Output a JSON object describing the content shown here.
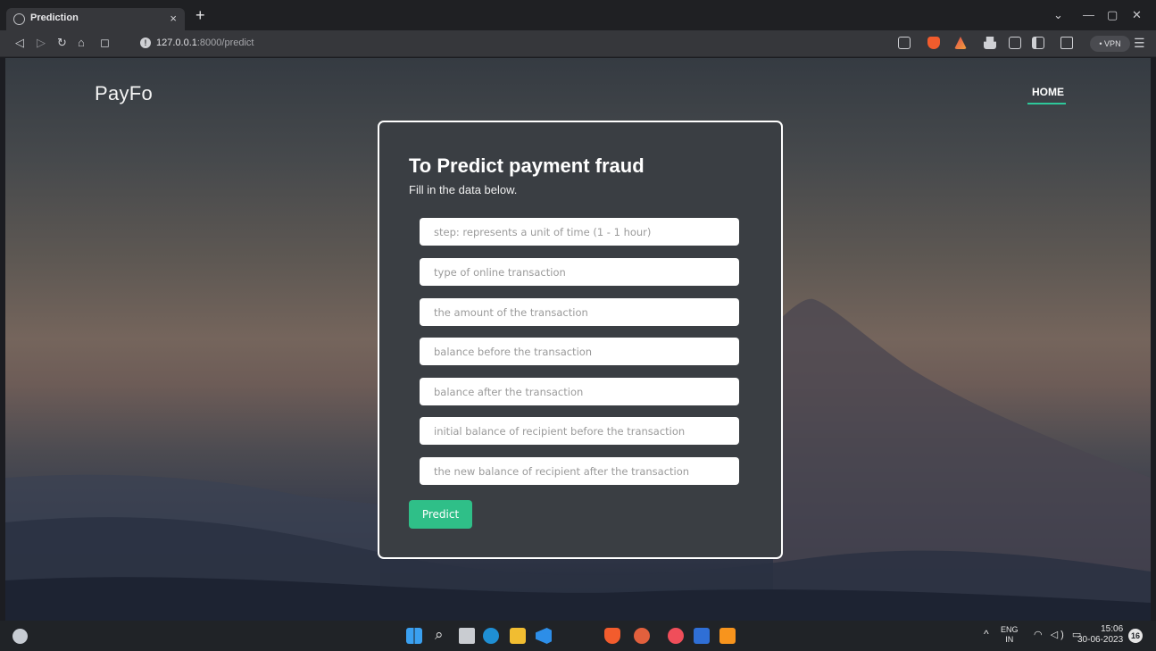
{
  "browser": {
    "tab_title": "Prediction",
    "tab_close": "×",
    "new_tab": "+",
    "url_host": "127.0.0.1",
    "url_path": ":8000/predict",
    "vpn_label": "• VPN",
    "window_controls": [
      "⌄",
      "—",
      "▢",
      "✕"
    ]
  },
  "page": {
    "brand": "PayFo",
    "nav_home": "HOME"
  },
  "form": {
    "title": "To Predict payment fraud",
    "subtitle": "Fill in the data below.",
    "fields": [
      {
        "placeholder": "step: represents a unit of time (1 - 1 hour)",
        "value": ""
      },
      {
        "placeholder": "type of online transaction",
        "value": ""
      },
      {
        "placeholder": "the amount of the transaction",
        "value": ""
      },
      {
        "placeholder": "balance before the transaction",
        "value": ""
      },
      {
        "placeholder": "balance after the transaction",
        "value": ""
      },
      {
        "placeholder": "initial balance of recipient before the transaction",
        "value": ""
      },
      {
        "placeholder": "the new balance of recipient after the transaction",
        "value": ""
      }
    ],
    "submit_label": "Predict"
  },
  "taskbar": {
    "lang_line1": "ENG",
    "lang_line2": "IN",
    "time": "15:06",
    "date": "30-06-2023",
    "notification_count": "16"
  },
  "colors": {
    "accent": "#2fbf88",
    "card": "#3a3e43"
  }
}
